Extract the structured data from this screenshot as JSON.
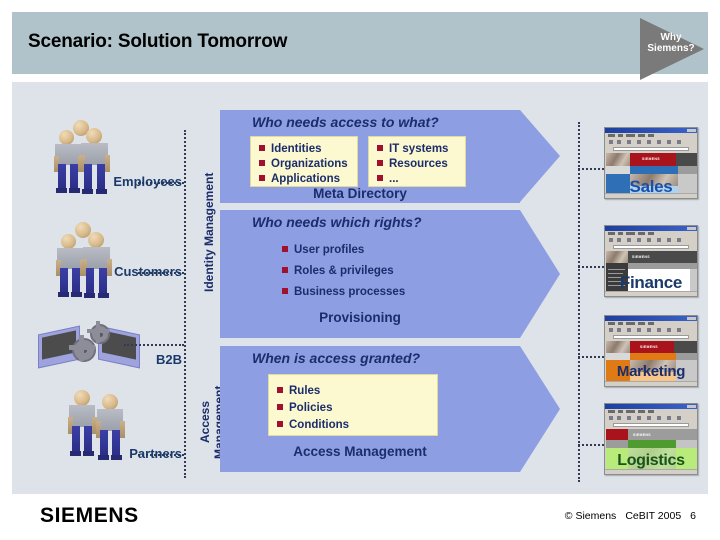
{
  "header": {
    "title": "Scenario: Solution Tomorrow",
    "why_badge_line1": "Why",
    "why_badge_line2": "Siemens?",
    "bar_color": "#b0c3ca",
    "badge_color": "#7a7a7a"
  },
  "main": {
    "headline": "Who needs access to what?",
    "background": "#dde3e8",
    "arrow_color": "#8e9ee2",
    "box_color": "#fcf8cf",
    "text_color": "#1b2d6b",
    "bullet_color": "#9e1230"
  },
  "actors": [
    {
      "label": "Employees",
      "icon": "people-group-icon"
    },
    {
      "label": "Customers",
      "icon": "people-group-icon"
    },
    {
      "label": "B2B",
      "icon": "monitors-gears-icon"
    },
    {
      "label": "Partners",
      "icon": "people-pair-icon"
    }
  ],
  "vertical_labels": [
    {
      "label": "Identity Management"
    },
    {
      "label": "Access",
      "label2": "Management"
    }
  ],
  "bands": [
    {
      "question": "Who needs access to what?",
      "footer": "Meta Directory",
      "boxed": true,
      "columns": [
        {
          "items": [
            "Identities",
            "Organizations",
            "Applications"
          ]
        },
        {
          "items": [
            "IT systems",
            "Resources",
            "..."
          ]
        }
      ]
    },
    {
      "question": "Who needs which rights?",
      "footer": "Provisioning",
      "boxed": false,
      "columns": [
        {
          "items": [
            "User profiles",
            "Roles & privileges",
            "Business processes"
          ]
        }
      ]
    },
    {
      "question": "When is access granted?",
      "footer": "Access Management",
      "boxed": true,
      "columns": [
        {
          "items": [
            "Rules",
            "Policies",
            "Conditions"
          ]
        }
      ]
    }
  ],
  "screenshots": [
    {
      "label": "Sales",
      "accent": "#2f6fb5",
      "tint": "#aed3f0",
      "text_color": "#1b50a8",
      "logo": "SIEMENS"
    },
    {
      "label": "Finance",
      "accent": "#4a4a4a",
      "tint": "#ffffff",
      "text_color": "#1b3a6b",
      "logo": "SIEMENS"
    },
    {
      "label": "Marketing",
      "accent": "#e07a14",
      "tint": "#f8c58a",
      "text_color": "#1b2d6b",
      "logo": "SIEMENS"
    },
    {
      "label": "Logistics",
      "accent": "#4f9b2f",
      "tint": "#b8eb7a",
      "text_color": "#18531a",
      "logo": "SIEMENS"
    }
  ],
  "footer": {
    "logo": "SIEMENS",
    "copyright": "© Siemens",
    "event": "CeBIT 2005",
    "page": "6"
  }
}
